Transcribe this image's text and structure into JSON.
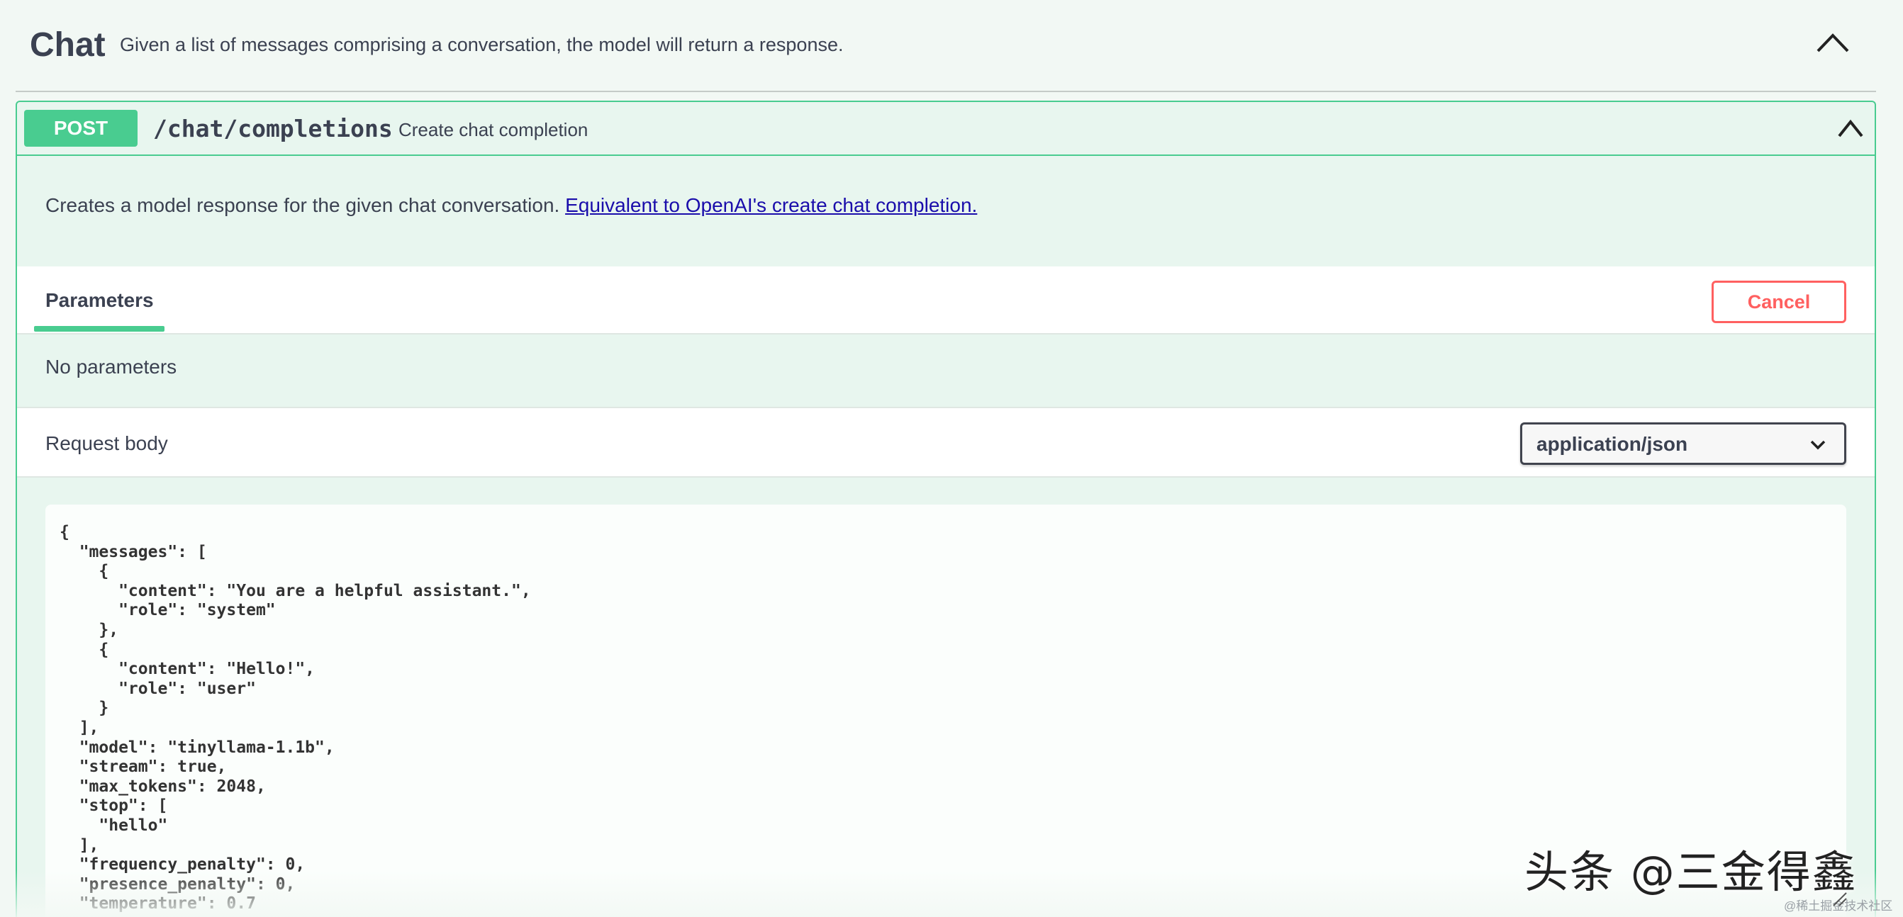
{
  "tag": {
    "title": "Chat",
    "description": "Given a list of messages comprising a conversation, the model will return a response.",
    "collapse_icon": "chevron-up-icon"
  },
  "operation": {
    "method": "POST",
    "path": "/chat/completions",
    "summary": "Create chat completion",
    "collapse_icon": "chevron-up-icon",
    "description": "Creates a model response for the given chat conversation.",
    "description_link": "Equivalent to OpenAI's create chat completion.",
    "colors": {
      "accent": "#49cc90",
      "cancel": "#ff6060",
      "link": "#1a0dab"
    }
  },
  "parameters": {
    "tab_label": "Parameters",
    "cancel_label": "Cancel",
    "empty_text": "No parameters"
  },
  "request_body": {
    "label": "Request body",
    "content_type": "application/json",
    "body": "{\n  \"messages\": [\n    {\n      \"content\": \"You are a helpful assistant.\",\n      \"role\": \"system\"\n    },\n    {\n      \"content\": \"Hello!\",\n      \"role\": \"user\"\n    }\n  ],\n  \"model\": \"tinyllama-1.1b\",\n  \"stream\": true,\n  \"max_tokens\": 2048,\n  \"stop\": [\n    \"hello\"\n  ],\n  \"frequency_penalty\": 0,\n  \"presence_penalty\": 0,\n  \"temperature\": 0.7"
  },
  "watermark": {
    "main": "头条 @三金得鑫",
    "small": "@稀土掘金技术社区"
  }
}
